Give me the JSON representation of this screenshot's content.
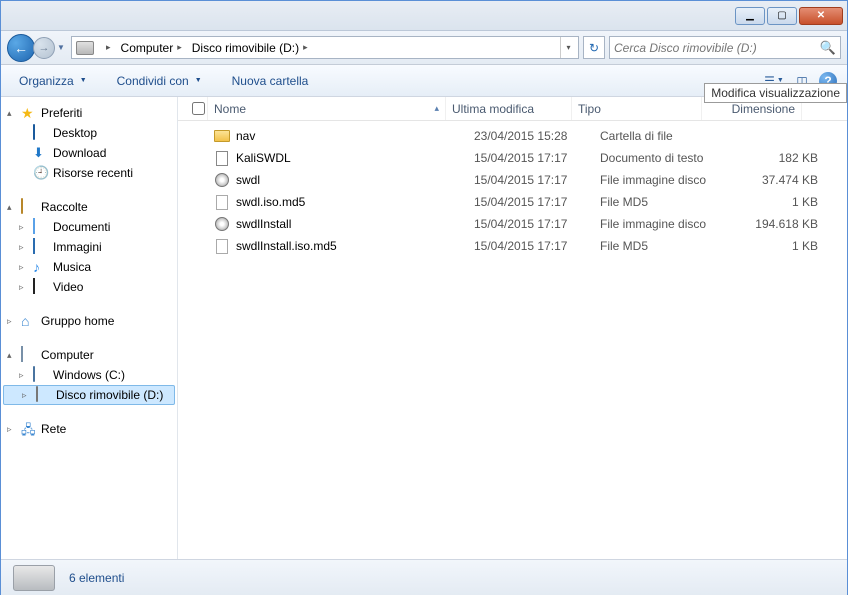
{
  "window_controls": {
    "minimize": "▁",
    "maximize": "▢",
    "close": "✕"
  },
  "breadcrumbs": [
    {
      "label": "Computer"
    },
    {
      "label": "Disco rimovibile (D:)"
    }
  ],
  "search": {
    "placeholder": "Cerca Disco rimovibile (D:)"
  },
  "toolbar": {
    "organize": "Organizza",
    "share": "Condividi con",
    "new_folder": "Nuova cartella"
  },
  "tooltip": "Modifica visualizzazione",
  "sidebar": {
    "favorites": {
      "label": "Preferiti",
      "items": [
        {
          "label": "Desktop",
          "icon": "desktop"
        },
        {
          "label": "Download",
          "icon": "download"
        },
        {
          "label": "Risorse recenti",
          "icon": "recent"
        }
      ]
    },
    "libraries": {
      "label": "Raccolte",
      "items": [
        {
          "label": "Documenti",
          "icon": "doc"
        },
        {
          "label": "Immagini",
          "icon": "img"
        },
        {
          "label": "Musica",
          "icon": "music"
        },
        {
          "label": "Video",
          "icon": "video"
        }
      ]
    },
    "homegroup": {
      "label": "Gruppo home"
    },
    "computer": {
      "label": "Computer",
      "items": [
        {
          "label": "Windows (C:)",
          "icon": "cdrive"
        },
        {
          "label": "Disco rimovibile (D:)",
          "icon": "removable",
          "selected": true
        }
      ]
    },
    "network": {
      "label": "Rete"
    }
  },
  "columns": {
    "name": "Nome",
    "modified": "Ultima modifica",
    "type": "Tipo",
    "size": "Dimensione"
  },
  "files": [
    {
      "name": "nav",
      "modified": "23/04/2015 15:28",
      "type": "Cartella di file",
      "size": "",
      "icon": "folder"
    },
    {
      "name": "KaliSWDL",
      "modified": "15/04/2015 17:17",
      "type": "Documento di testo",
      "size": "182 KB",
      "icon": "txt"
    },
    {
      "name": "swdl",
      "modified": "15/04/2015 17:17",
      "type": "File immagine disco",
      "size": "37.474 KB",
      "icon": "disc"
    },
    {
      "name": "swdl.iso.md5",
      "modified": "15/04/2015 17:17",
      "type": "File MD5",
      "size": "1 KB",
      "icon": "file"
    },
    {
      "name": "swdlInstall",
      "modified": "15/04/2015 17:17",
      "type": "File immagine disco",
      "size": "194.618 KB",
      "icon": "disc"
    },
    {
      "name": "swdlInstall.iso.md5",
      "modified": "15/04/2015 17:17",
      "type": "File MD5",
      "size": "1 KB",
      "icon": "file"
    }
  ],
  "status": {
    "count": "6 elementi"
  }
}
